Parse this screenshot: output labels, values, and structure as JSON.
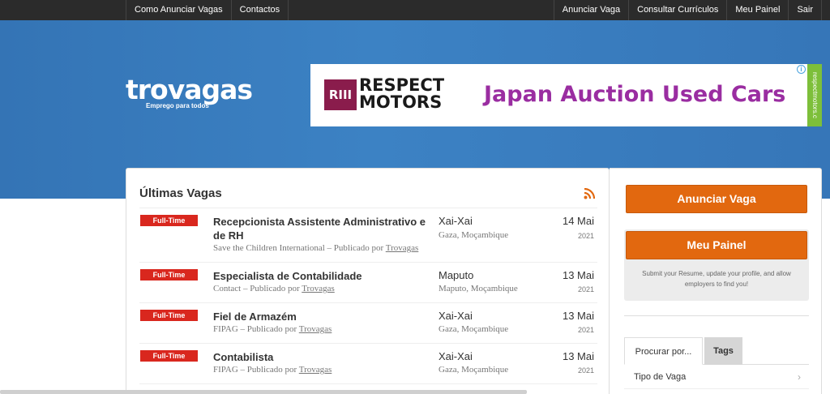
{
  "topnav": {
    "left": [
      "Como Anunciar Vagas",
      "Contactos"
    ],
    "right": [
      "Anunciar Vaga",
      "Consultar Currículos",
      "Meu Painel",
      "Sair"
    ]
  },
  "logo": {
    "name": "trovagas",
    "tagline": "Emprego para todos"
  },
  "ad": {
    "brand_mark": "RIII",
    "brand_name": "RESPECT MOTORS",
    "headline": "Japan Auction Used Cars",
    "side_url": "respectmotors.c",
    "info_icon": "info-icon",
    "close_icon": "close-icon"
  },
  "main": {
    "title": "Últimas Vagas",
    "rss_icon": "rss-icon",
    "jobs": [
      {
        "badge": "Full-Time",
        "title": "Recepcionista Assistente Administrativo e de RH",
        "company": "Save the Children International",
        "published": "Publicado por",
        "poster": "Trovagas",
        "city": "Xai-Xai",
        "region": "Gaza, Moçambique",
        "day": "14 Mai",
        "year": "2021"
      },
      {
        "badge": "Full-Time",
        "title": "Especialista de Contabilidade",
        "company": "Contact",
        "published": "Publicado por",
        "poster": "Trovagas",
        "city": "Maputo",
        "region": "Maputo, Moçambique",
        "day": "13 Mai",
        "year": "2021"
      },
      {
        "badge": "Full-Time",
        "title": "Fiel de Armazém",
        "company": "FIPAG",
        "published": "Publicado por",
        "poster": "Trovagas",
        "city": "Xai-Xai",
        "region": "Gaza, Moçambique",
        "day": "13 Mai",
        "year": "2021"
      },
      {
        "badge": "Full-Time",
        "title": "Contabilista",
        "company": "FIPAG",
        "published": "Publicado por",
        "poster": "Trovagas",
        "city": "Xai-Xai",
        "region": "Gaza, Moçambique",
        "day": "13 Mai",
        "year": "2021"
      }
    ]
  },
  "sidebar": {
    "post_job": "Anunciar Vaga",
    "dashboard": "Meu Painel",
    "dashboard_desc": "Submit your Resume, update your profile, and allow employers to find you!",
    "tabs": [
      "Procurar por...",
      "Tags"
    ],
    "filters": [
      "Tipo de Vaga"
    ]
  },
  "colors": {
    "hero": "#3a7fc1",
    "accent": "#e2680f",
    "badge": "#d9271e",
    "topbar": "#2b2b2b"
  }
}
